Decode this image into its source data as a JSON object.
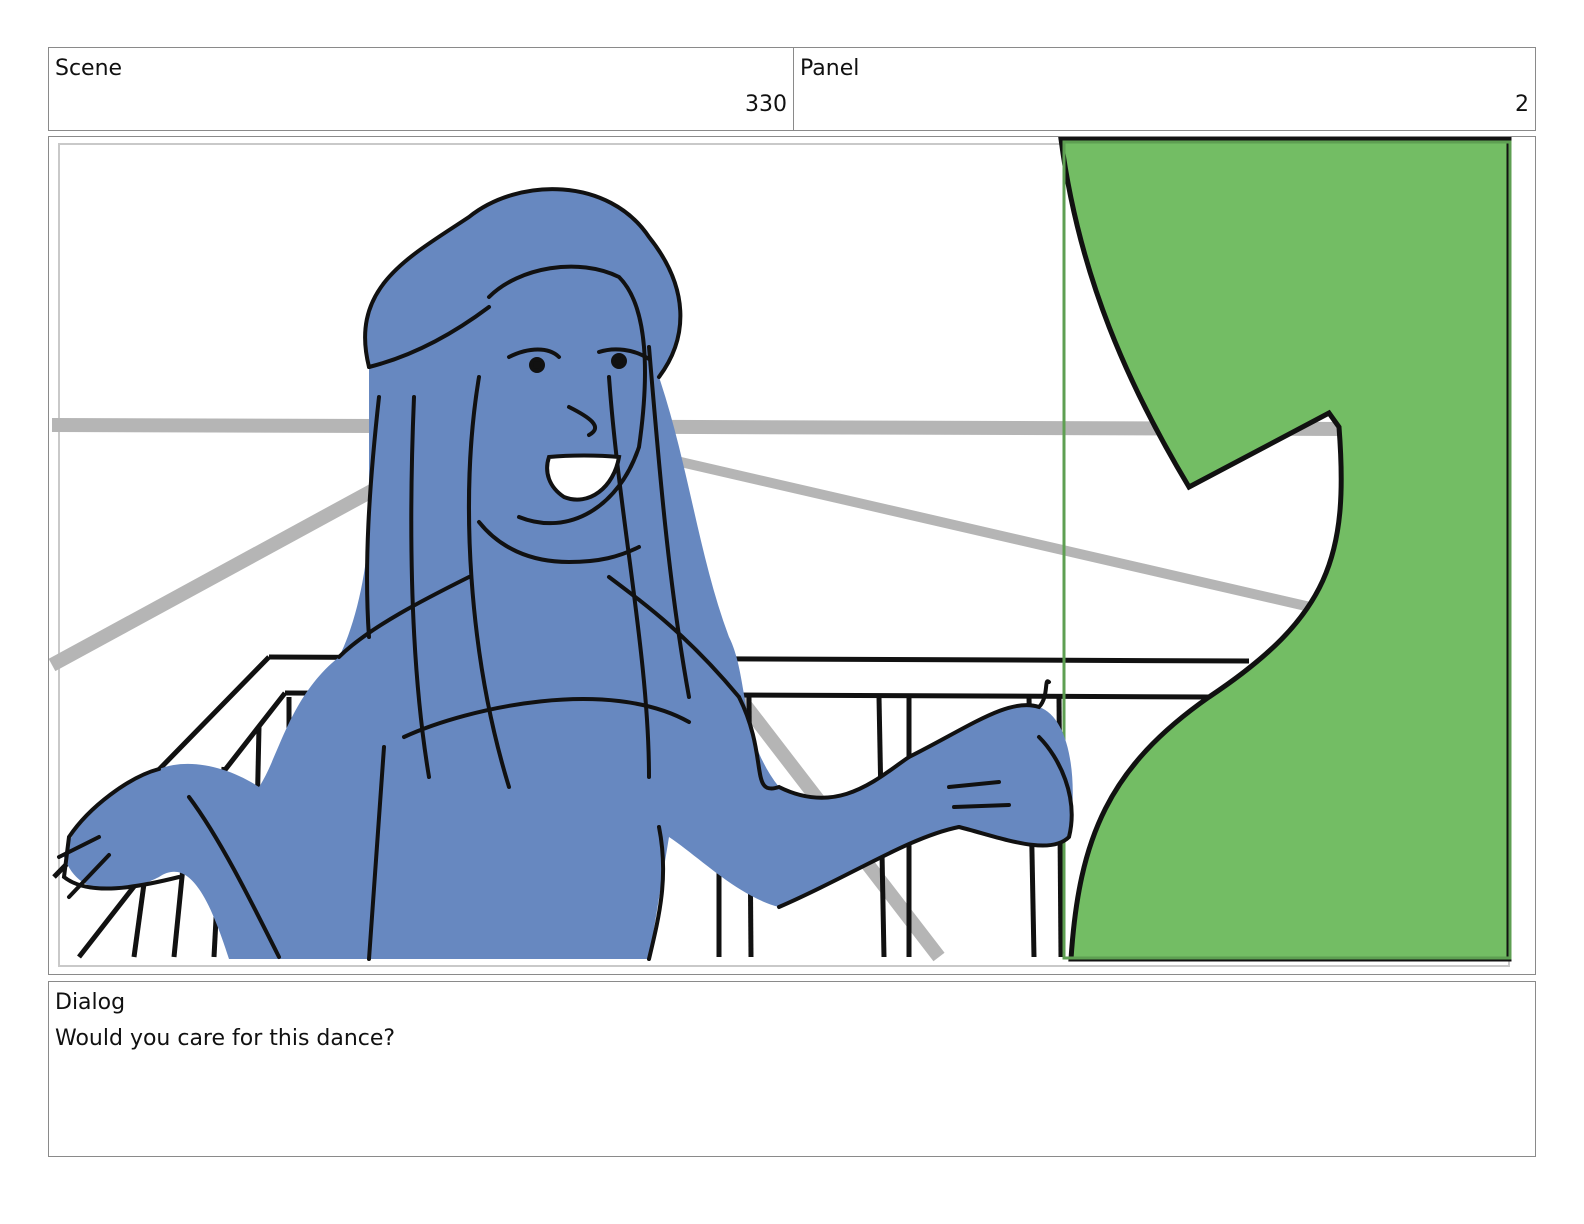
{
  "header": {
    "scene_label": "Scene",
    "scene_value": "330",
    "panel_label": "Panel",
    "panel_value": "2"
  },
  "artwork": {
    "subject": "storyboard-sketch",
    "colors": {
      "figure": "#6788c0",
      "curtain": "#73bd64",
      "rail_gray": "#b5b5b5",
      "line": "#111111"
    }
  },
  "dialog": {
    "label": "Dialog",
    "text": "Would you care for this dance?"
  }
}
